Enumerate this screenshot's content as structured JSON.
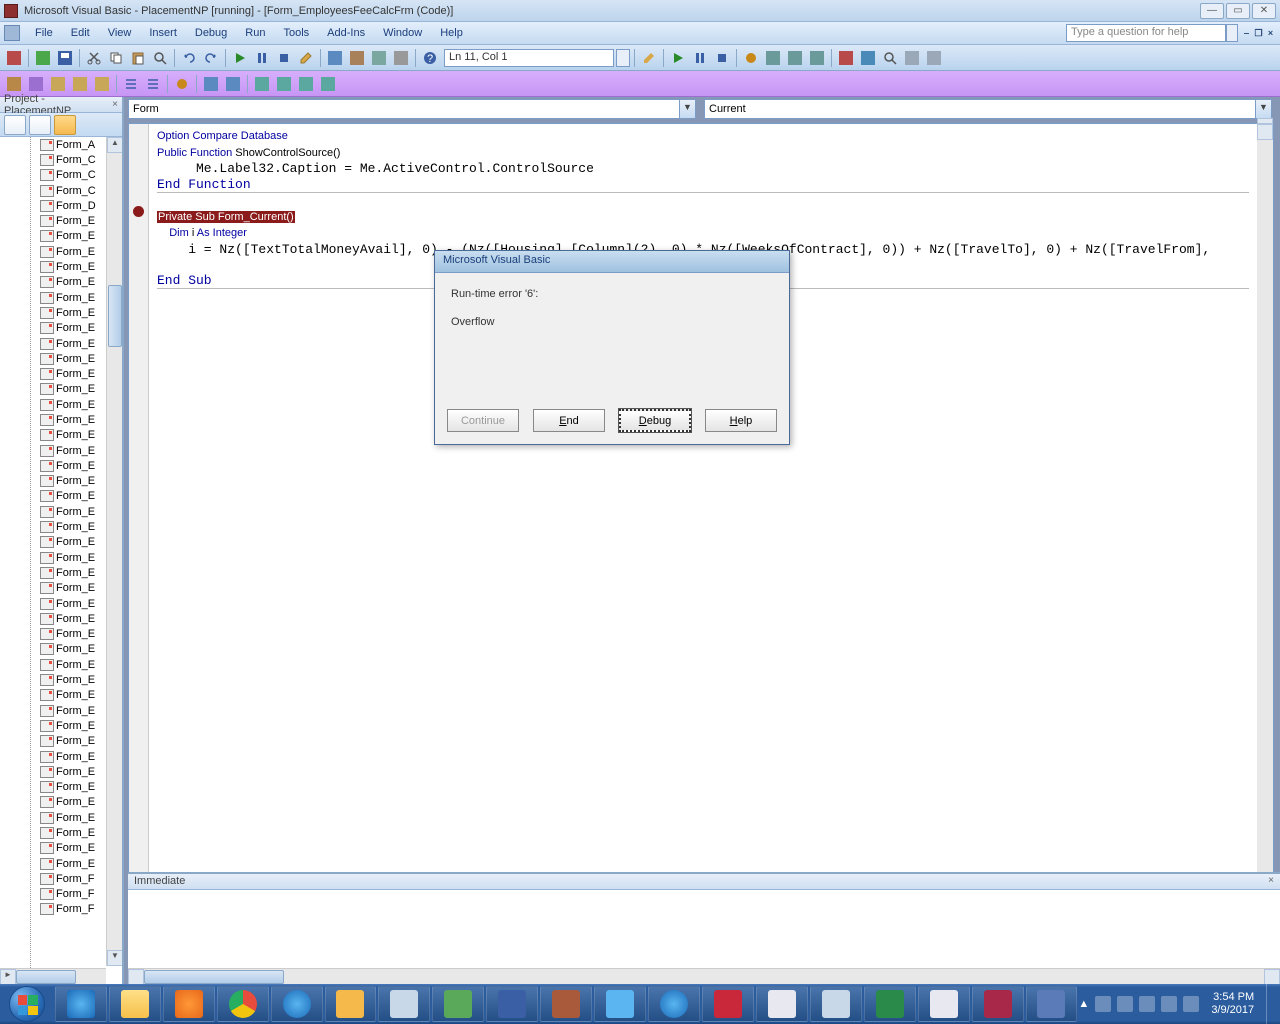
{
  "title": "Microsoft Visual Basic - PlacementNP [running] - [Form_EmployeesFeeCalcFrm (Code)]",
  "menu": [
    "File",
    "Edit",
    "View",
    "Insert",
    "Debug",
    "Run",
    "Tools",
    "Add-Ins",
    "Window",
    "Help"
  ],
  "help_placeholder": "Type a question for help",
  "cursor_pos": "Ln 11, Col 1",
  "project_title": "Project - PlacementNP",
  "tree_items": [
    "Form_A",
    "Form_C",
    "Form_C",
    "Form_C",
    "Form_D",
    "Form_E",
    "Form_E",
    "Form_E",
    "Form_E",
    "Form_E",
    "Form_E",
    "Form_E",
    "Form_E",
    "Form_E",
    "Form_E",
    "Form_E",
    "Form_E",
    "Form_E",
    "Form_E",
    "Form_E",
    "Form_E",
    "Form_E",
    "Form_E",
    "Form_E",
    "Form_E",
    "Form_E",
    "Form_E",
    "Form_E",
    "Form_E",
    "Form_E",
    "Form_E",
    "Form_E",
    "Form_E",
    "Form_E",
    "Form_E",
    "Form_E",
    "Form_E",
    "Form_E",
    "Form_E",
    "Form_E",
    "Form_E",
    "Form_E",
    "Form_E",
    "Form_E",
    "Form_E",
    "Form_E",
    "Form_E",
    "Form_E",
    "Form_F",
    "Form_F",
    "Form_F"
  ],
  "object_dd": "Form",
  "proc_dd": "Current",
  "code": {
    "l1": "Option Compare Database",
    "l2a": "Public Function ",
    "l2b": "ShowControlSource()",
    "l3": "     Me.Label32.Caption = Me.ActiveControl.ControlSource",
    "l4": "End Function",
    "l6": "Private Sub Form_Current()",
    "l7a": "    Dim ",
    "l7b": "i ",
    "l7c": "As ",
    "l7d": "Integer",
    "l8": "    i = Nz([TextTotalMoneyAvail], 0) - (Nz([Housing].[Column](2), 0) * Nz([WeeksOfContract], 0)) + Nz([TravelTo], 0) + Nz([TravelFrom],",
    "l10": "End Sub"
  },
  "immediate_title": "Immediate",
  "error": {
    "title": "Microsoft Visual Basic",
    "line1": "Run-time error '6':",
    "line2": "Overflow",
    "continue": "Continue",
    "end": "End",
    "debug": "Debug",
    "help": "Help"
  },
  "tray": {
    "time": "3:54 PM",
    "date": "3/9/2017"
  }
}
